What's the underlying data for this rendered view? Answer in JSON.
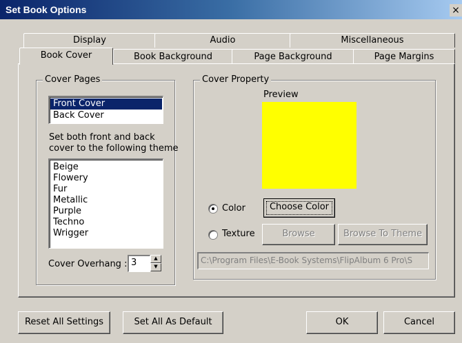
{
  "window": {
    "title": "Set Book Options",
    "close_glyph": "×"
  },
  "tabs_row_back": [
    {
      "label": "Display"
    },
    {
      "label": "Audio"
    },
    {
      "label": "Miscellaneous"
    }
  ],
  "tabs_row_front": [
    {
      "label": "Book Cover",
      "active": true
    },
    {
      "label": "Book Background"
    },
    {
      "label": "Page Background"
    },
    {
      "label": "Page Margins"
    }
  ],
  "cover_pages": {
    "group_label": "Cover Pages",
    "items": [
      "Front Cover",
      "Back Cover"
    ],
    "selected": "Front Cover",
    "theme_caption_line1": "Set both front and back",
    "theme_caption_line2": "cover to the following theme",
    "themes": [
      "Beige",
      "Flowery",
      "Fur",
      "Metallic",
      "Purple",
      "Techno",
      "Wrigger"
    ],
    "overhang_label": "Cover Overhang :",
    "overhang_value": "3"
  },
  "cover_property": {
    "group_label": "Cover Property",
    "preview_label": "Preview",
    "preview_color": "#ffff00",
    "color_option_label": "Color",
    "texture_option_label": "Texture",
    "selected_option": "Color",
    "choose_color_label": "Choose Color",
    "browse_label": "Browse",
    "browse_theme_label": "Browse To Theme",
    "path_value": "C:\\Program Files\\E-Book Systems\\FlipAlbum 6 Pro\\S"
  },
  "footer": {
    "reset_label": "Reset All Settings",
    "default_label": "Set All As Default",
    "ok_label": "OK",
    "cancel_label": "Cancel"
  }
}
